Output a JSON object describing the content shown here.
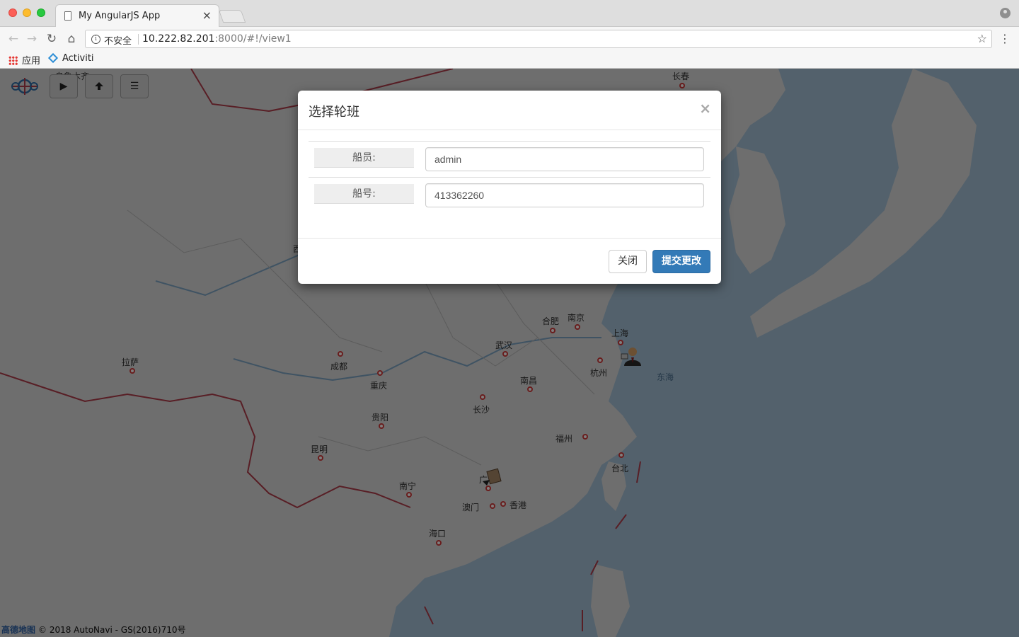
{
  "browser": {
    "tab_title": "My AngularJS App",
    "tab_close": "×",
    "security_label": "不安全",
    "url_host": "10.222.82.201",
    "url_rest": ":8000/#!/view1",
    "back_icon": "←",
    "forward_icon": "→",
    "reload_icon": "↻",
    "home_icon": "⌂",
    "star_icon": "☆",
    "menu_icon": "⋮"
  },
  "bookmarks": [
    {
      "label": "应用",
      "icon": "apps-grid-icon"
    },
    {
      "label": "Activiti",
      "icon": "activiti-diamond-icon"
    }
  ],
  "map": {
    "controls": {
      "play_icon": "▶",
      "menu_icon": "☰"
    },
    "cities": {
      "changchun": "长春",
      "urumqi": "乌鲁木齐",
      "xi": "西",
      "hefei": "合肥",
      "nanjing": "南京",
      "shanghai": "上海",
      "wuhan": "武汉",
      "hangzhou": "杭州",
      "chengdu": "成都",
      "chongqing": "重庆",
      "lhasa": "拉萨",
      "nanchang": "南昌",
      "changsha": "长沙",
      "guiyang": "贵阳",
      "fuzhou": "福州",
      "taipei": "台北",
      "kunming": "昆明",
      "nanning": "南宁",
      "guangzhou": "广",
      "macau": "澳门",
      "hongkong": "香港",
      "haikou": "海口"
    },
    "sea_label": "东海",
    "copyright_brand": "高德地图",
    "copyright_text": "© 2018 AutoNavi - GS(2016)710号",
    "markers": [
      "crew-person-icon",
      "ship-icon"
    ]
  },
  "modal": {
    "title": "选择轮班",
    "close_icon": "×",
    "fields": [
      {
        "label": "船员:",
        "value": "admin"
      },
      {
        "label": "船号:",
        "value": "413362260"
      }
    ],
    "close_button": "关闭",
    "submit_button": "提交更改"
  },
  "colors": {
    "primary_button": "#337ab7",
    "city_dot": "#d23a3a",
    "sea": "#a6c3d9",
    "land": "#dcdcdc"
  }
}
